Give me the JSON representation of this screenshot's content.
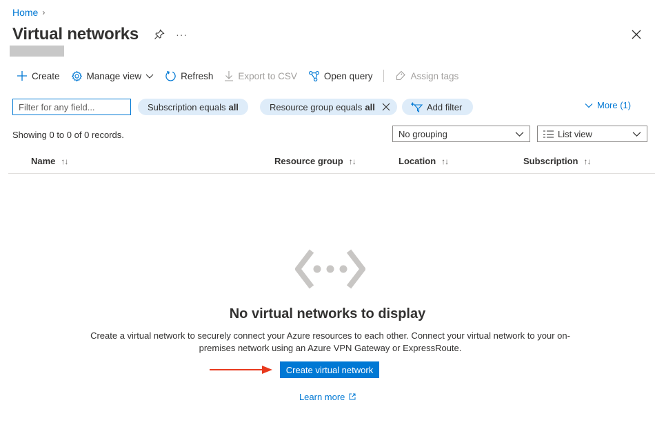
{
  "breadcrumb": {
    "home": "Home"
  },
  "header": {
    "title": "Virtual networks",
    "more": "···"
  },
  "toolbar": {
    "create": "Create",
    "manage_view": "Manage view",
    "refresh": "Refresh",
    "export_csv": "Export to CSV",
    "open_query": "Open query",
    "assign_tags": "Assign tags"
  },
  "filters": {
    "placeholder": "Filter for any field...",
    "subscription": {
      "label": "Subscription equals",
      "value": "all"
    },
    "resource_group": {
      "label": "Resource group equals",
      "value": "all"
    },
    "add_filter": "Add filter",
    "more": "More (1)"
  },
  "records_text": "Showing 0 to 0 of 0 records.",
  "grouping": {
    "selected": "No grouping"
  },
  "view": {
    "selected": "List view"
  },
  "columns": [
    {
      "label": "Name"
    },
    {
      "label": "Resource group"
    },
    {
      "label": "Location"
    },
    {
      "label": "Subscription"
    }
  ],
  "empty_state": {
    "title": "No virtual networks to display",
    "description": "Create a virtual network to securely connect your Azure resources to each other. Connect your virtual network to your on-premises network using an Azure VPN Gateway or ExpressRoute.",
    "cta": "Create virtual network",
    "learn_more": "Learn more"
  },
  "colors": {
    "accent": "#0078d4",
    "pill": "#deecf9",
    "annotation_arrow": "#e8391d"
  }
}
